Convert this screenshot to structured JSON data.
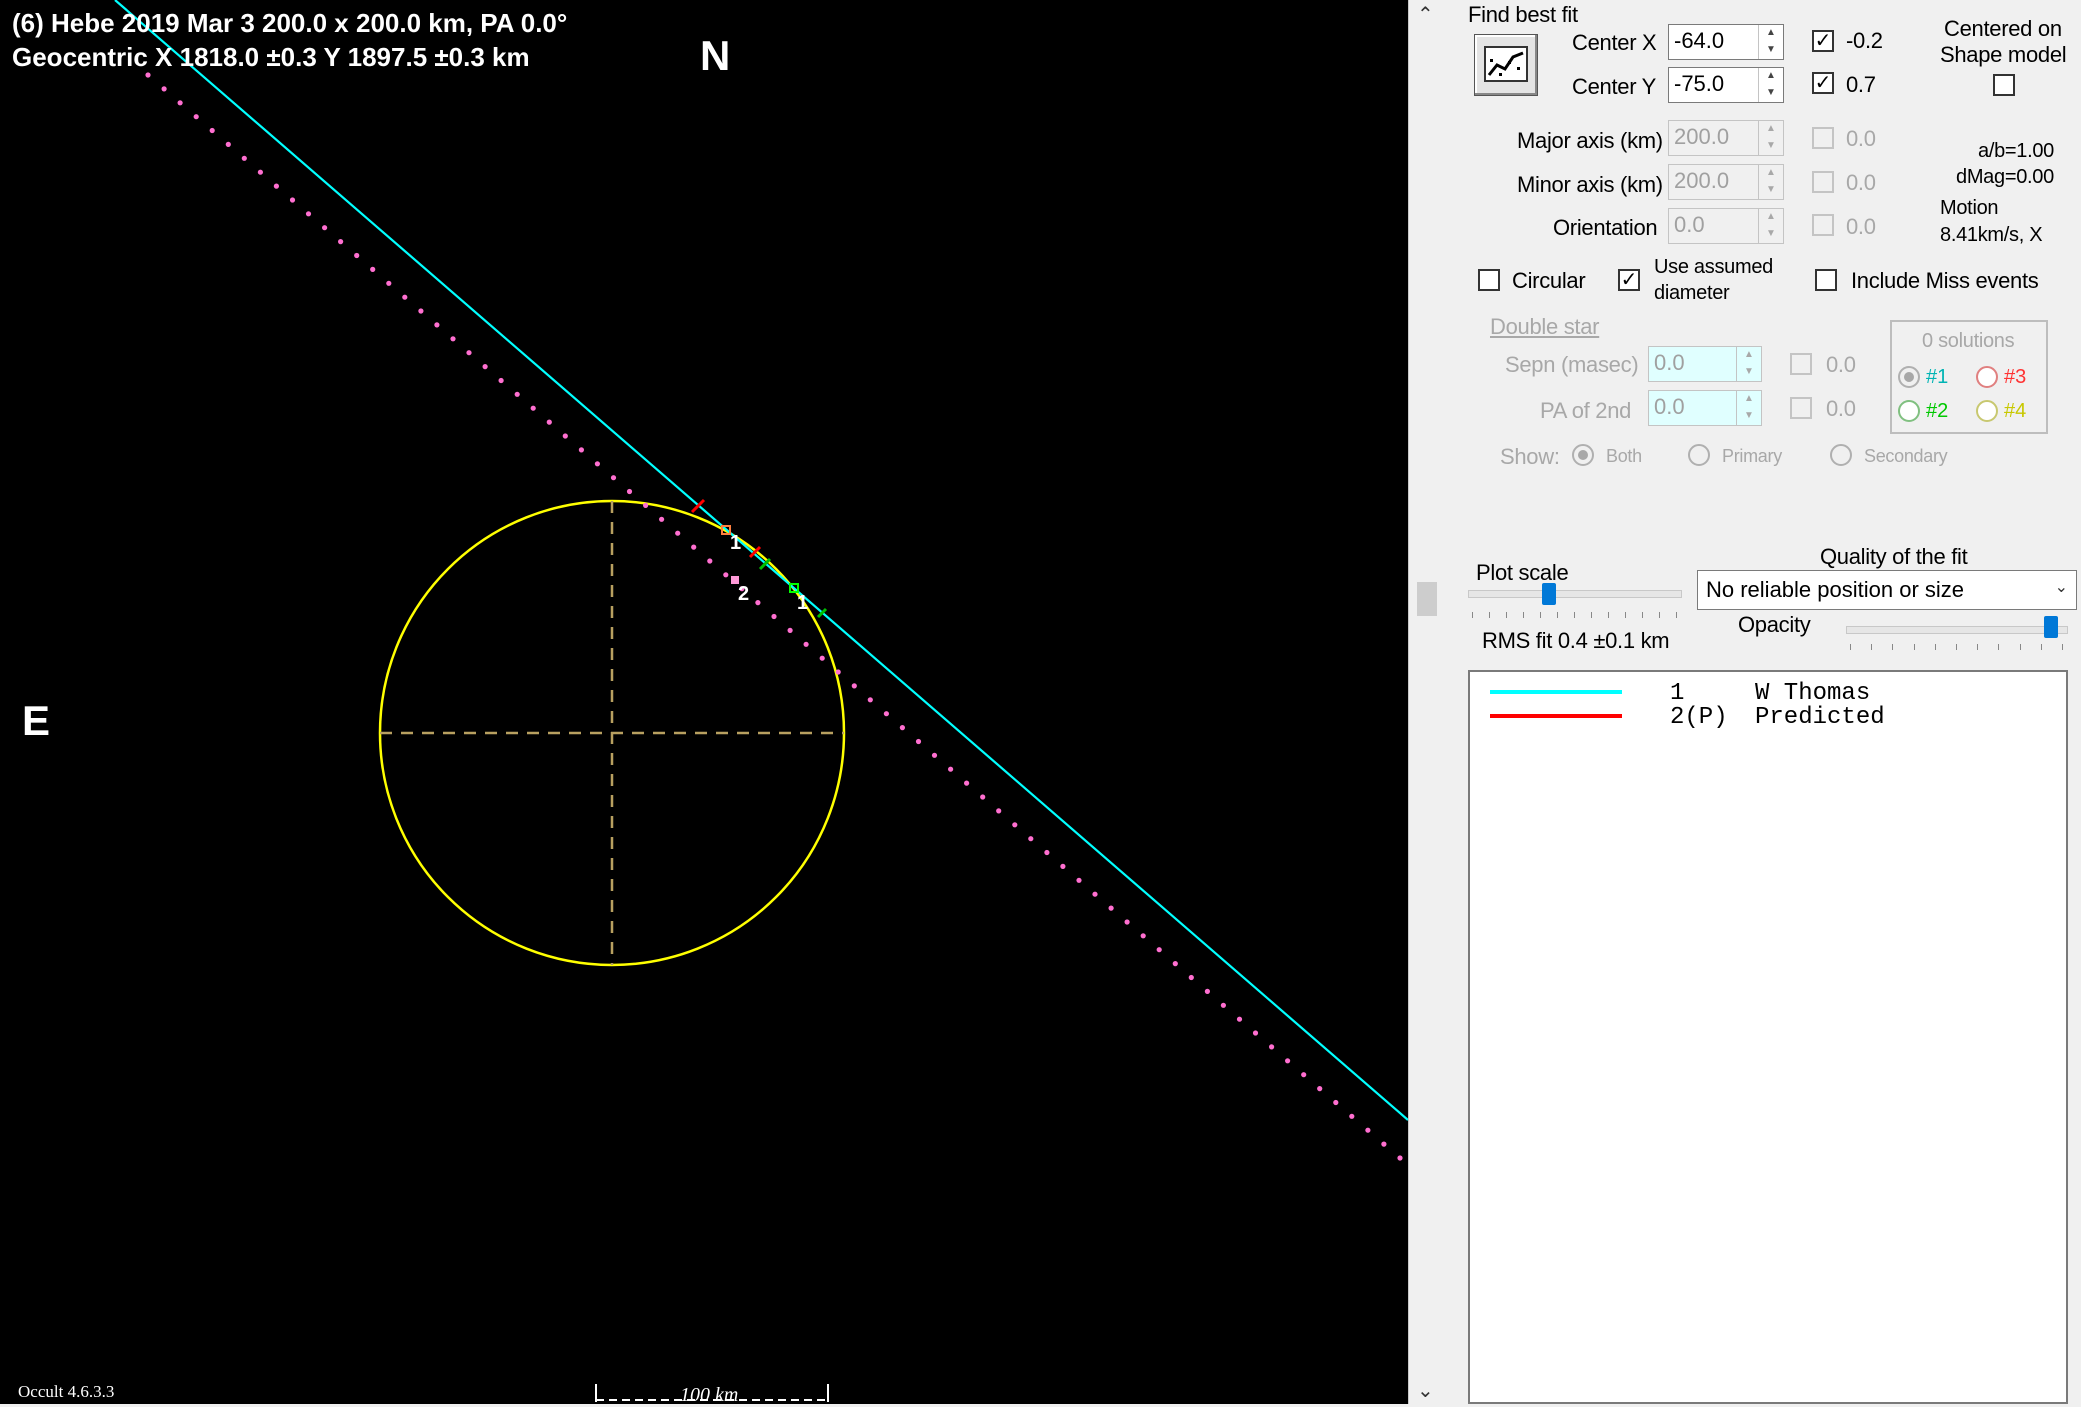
{
  "plot": {
    "title": "(6) Hebe  2019 Mar 3  200.0 x 200.0 km, PA 0.0°",
    "coords": "Geocentric  X  1818.0 ±0.3  Y  1897.5 ±0.3 km",
    "north_label": "N",
    "east_label": "E",
    "version": "Occult 4.6.3.3",
    "scale_label": "100 km",
    "chord_labels": [
      "1",
      "1",
      "2"
    ],
    "colors": {
      "background": "#000000",
      "ellipse": "#ffff00",
      "observed_chord": "#00ffff",
      "predicted_path": "#ff6fd0",
      "disappear_marker": "#ff0000",
      "reappear_marker": "#00ff00"
    }
  },
  "panel": {
    "find_best_fit": "Find best fit",
    "find_button_icon": "fit-curve-icon",
    "center_x": {
      "label": "Center X",
      "value": "-64.0",
      "checked": true,
      "offset": "-0.2"
    },
    "center_y": {
      "label": "Center Y",
      "value": "-75.0",
      "checked": true,
      "offset": "0.7"
    },
    "major_axis": {
      "label": "Major axis (km)",
      "value": "200.0",
      "offset": "0.0"
    },
    "minor_axis": {
      "label": "Minor axis (km)",
      "value": "200.0",
      "offset": "0.0"
    },
    "orientation": {
      "label": "Orientation",
      "value": "0.0",
      "offset": "0.0"
    },
    "centered_on_line1": "Centered on",
    "centered_on_line2": "Shape model",
    "ab_ratio": "a/b=1.00",
    "dmag": "dMag=0.00",
    "motion_line1": "Motion",
    "motion_line2": "8.41km/s, X",
    "circular": "Circular",
    "use_assumed_line1": "Use assumed",
    "use_assumed_line2": "diameter",
    "include_miss": "Include Miss events",
    "double_star": {
      "title": "Double star",
      "sepn_label": "Sepn (masec)",
      "sepn_value": "0.0",
      "sepn_offset": "0.0",
      "pa_label": "PA of 2nd",
      "pa_value": "0.0",
      "pa_offset": "0.0",
      "show_label": "Show:",
      "show_options": [
        "Both",
        "Primary",
        "Secondary"
      ]
    },
    "solutions": {
      "count_label": "0 solutions",
      "items": [
        {
          "label": "#1",
          "color": "#00b4b4"
        },
        {
          "label": "#3",
          "color": "#ff3333"
        },
        {
          "label": "#2",
          "color": "#00c800"
        },
        {
          "label": "#4",
          "color": "#c8c800"
        }
      ]
    },
    "plot_scale": "Plot scale",
    "quality_label": "Quality of the fit",
    "quality_value": "No reliable position or size",
    "opacity": "Opacity",
    "rms_fit": "RMS fit 0.4 ±0.1 km"
  },
  "legend": [
    {
      "num": "1",
      "name": "W Thomas",
      "color": "#00ffff"
    },
    {
      "num": "2(P)",
      "name": "Predicted",
      "color": "#ff0000"
    }
  ]
}
